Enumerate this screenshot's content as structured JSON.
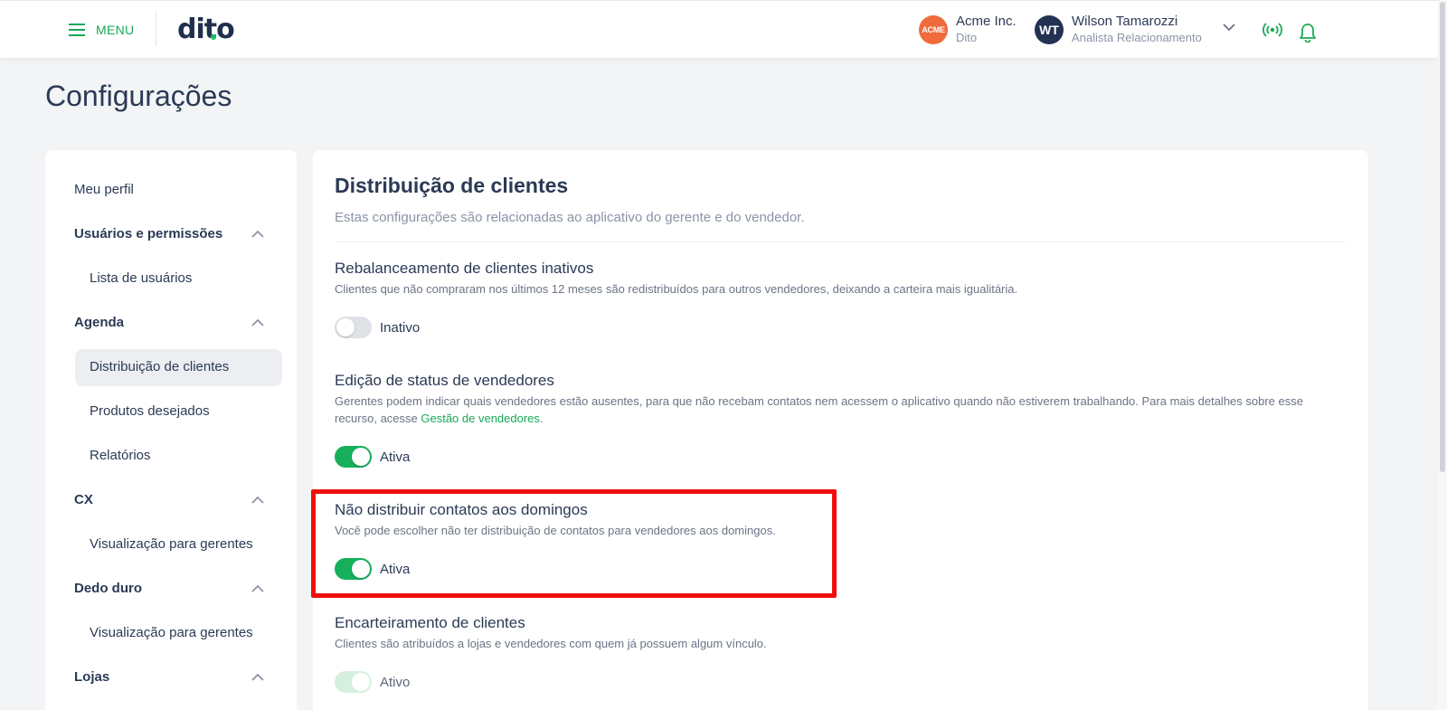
{
  "header": {
    "menu_label": "MENU",
    "logo_text": "dito",
    "company": {
      "badge": "ACME",
      "name": "Acme Inc.",
      "sub": "Dito"
    },
    "user": {
      "initials": "WT",
      "name": "Wilson Tamarozzi",
      "role": "Analista Relacionamento"
    }
  },
  "page": {
    "title": "Configurações"
  },
  "sidebar": {
    "profile": "Meu perfil",
    "groups": [
      {
        "label": "Usuários e permissões",
        "items": [
          "Lista de usuários"
        ]
      },
      {
        "label": "Agenda",
        "items": [
          "Distribuição de clientes",
          "Produtos desejados",
          "Relatórios"
        ]
      },
      {
        "label": "CX",
        "items": [
          "Visualização para gerentes"
        ]
      },
      {
        "label": "Dedo duro",
        "items": [
          "Visualização para gerentes"
        ]
      },
      {
        "label": "Lojas",
        "items": []
      }
    ],
    "active_item": "Distribuição de clientes"
  },
  "main": {
    "title": "Distribuição de clientes",
    "subtitle": "Estas configurações são relacionadas ao aplicativo do gerente e do vendedor.",
    "settings": [
      {
        "title": "Rebalanceamento de clientes inativos",
        "desc": "Clientes que não compraram nos últimos 12 meses são redistribuídos para outros vendedores, deixando a carteira mais igualitária.",
        "state": "Inativo",
        "enabled": false
      },
      {
        "title": "Edição de status de vendedores",
        "desc_before": "Gerentes podem indicar quais vendedores estão ausentes, para que não recebam contatos nem acessem o aplicativo quando não estiverem trabalhando. Para mais detalhes sobre esse recurso, acesse ",
        "desc_link": "Gestão de vendedores",
        "desc_after": ".",
        "state": "Ativa",
        "enabled": true
      },
      {
        "title": "Não distribuir contatos aos domingos",
        "desc": "Você pode escolher não ter distribuição de contatos para vendedores aos domingos.",
        "state": "Ativa",
        "enabled": true
      },
      {
        "title": "Encarteiramento de clientes",
        "desc": "Clientes são atribuídos a lojas e vendedores com quem já possuem algum vínculo.",
        "state": "Ativo",
        "enabled": true
      }
    ]
  },
  "colors": {
    "accent_green": "#16b05c",
    "highlight_red": "#f20d0d",
    "text_dark": "#2b3a55"
  }
}
